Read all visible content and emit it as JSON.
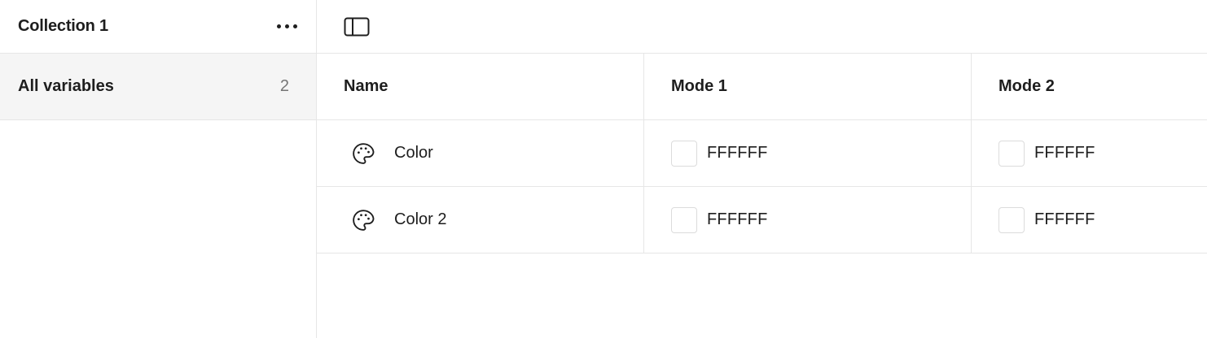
{
  "sidebar": {
    "collection_title": "Collection 1",
    "more_icon": "more-horizontal-icon",
    "items": [
      {
        "label": "All variables",
        "count": "2"
      }
    ]
  },
  "toolbar": {
    "toggle_icon": "sidebar-toggle-icon"
  },
  "table": {
    "columns": [
      "Name",
      "Mode 1",
      "Mode 2"
    ],
    "rows": [
      {
        "icon": "palette-icon",
        "name": "Color",
        "mode1": "FFFFFF",
        "mode2": "FFFFFF",
        "swatch_color": "#FFFFFF"
      },
      {
        "icon": "palette-icon",
        "name": "Color 2",
        "mode1": "FFFFFF",
        "mode2": "FFFFFF",
        "swatch_color": "#FFFFFF"
      }
    ]
  }
}
